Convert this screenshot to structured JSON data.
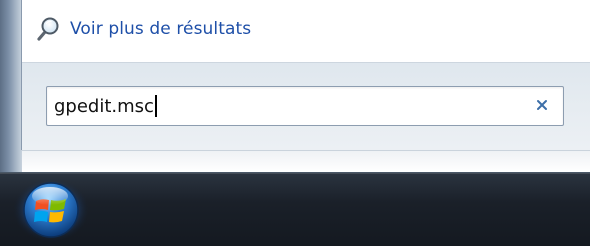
{
  "start_menu": {
    "more_results_label": "Voir plus de résultats",
    "more_results_icon": "search-icon",
    "search": {
      "value": "gpedit.msc",
      "clear_icon": "close-icon"
    }
  },
  "taskbar": {
    "start_button_icon": "windows-logo-icon"
  },
  "colors": {
    "link": "#1e4fa8",
    "search_band": "#e3e9ef",
    "taskbar": "#1a2029"
  }
}
